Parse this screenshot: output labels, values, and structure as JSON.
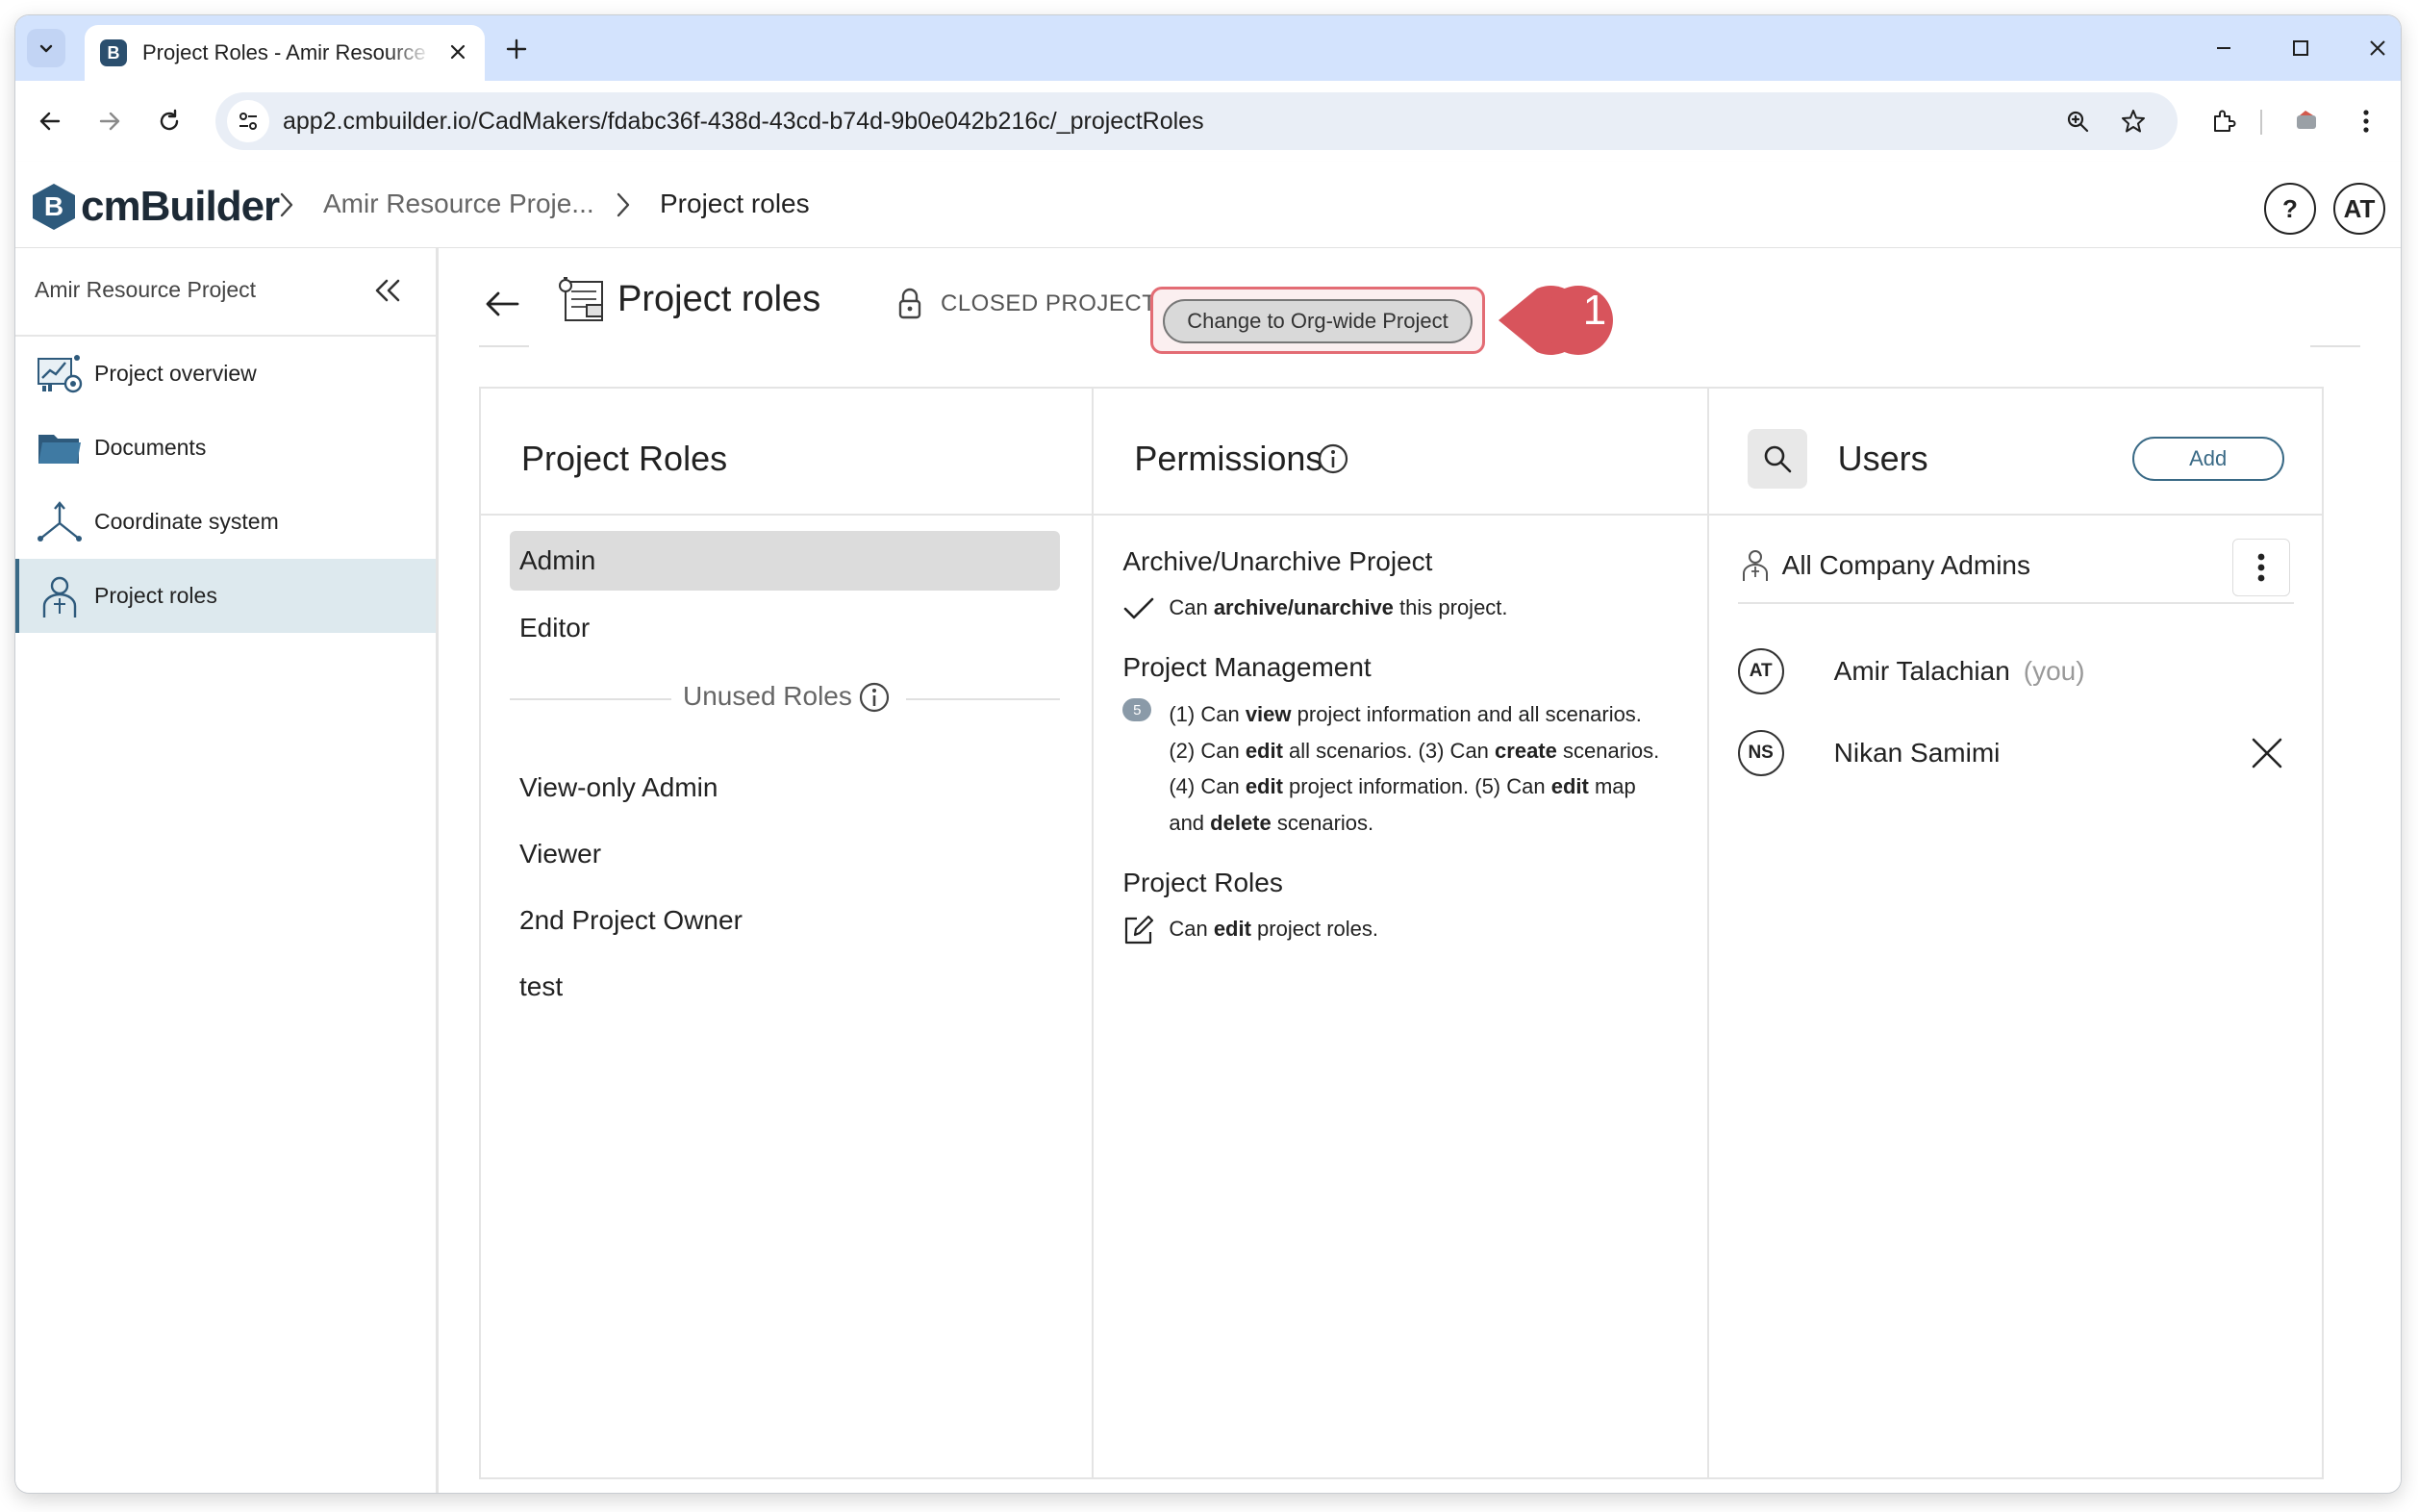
{
  "browser": {
    "tab_title": "Project Roles - Amir Resource Project",
    "favicon_letter": "B",
    "url": "app2.cmbuilder.io/CadMakers/fdabc36f-438d-43cd-b74d-9b0e042b216c/_projectRoles"
  },
  "header": {
    "logo_letter": "B",
    "logo_text": "cmBuilder",
    "breadcrumb_project": "Amir Resource Proje...",
    "breadcrumb_page": "Project roles",
    "help_label": "?",
    "avatar_initials": "AT"
  },
  "sidebar": {
    "project_name": "Amir Resource Project",
    "items": [
      {
        "label": "Project overview",
        "icon": "chart-dashboard-icon"
      },
      {
        "label": "Documents",
        "icon": "folder-icon"
      },
      {
        "label": "Coordinate system",
        "icon": "axes-icon"
      },
      {
        "label": "Project roles",
        "icon": "user-badge-icon",
        "active": true
      }
    ]
  },
  "page": {
    "title": "Project roles",
    "status": "CLOSED PROJECT",
    "change_button": "Change to Org-wide Project",
    "callout_number": "1"
  },
  "roles_panel": {
    "title": "Project Roles",
    "used_roles": [
      "Admin",
      "Editor"
    ],
    "unused_label": "Unused Roles",
    "unused_roles": [
      "View-only Admin",
      "Viewer",
      "2nd Project Owner",
      "test"
    ],
    "selected": "Admin"
  },
  "permissions_panel": {
    "title": "Permissions",
    "sections": [
      {
        "title": "Archive/Unarchive Project",
        "lines": [
          [
            "Can ",
            "archive/unarchive",
            " this project."
          ]
        ]
      },
      {
        "title": "Project Management",
        "badge": "5",
        "lines": [
          [
            "(1) Can ",
            "view",
            " project information and all scenarios."
          ],
          [
            "(2) Can ",
            "edit",
            " all scenarios. (3) Can ",
            "create",
            " scenarios."
          ],
          [
            "(4) Can ",
            "edit",
            " project information. (5) Can ",
            "edit",
            " map"
          ],
          [
            "and ",
            "delete",
            " scenarios."
          ]
        ]
      },
      {
        "title": "Project Roles",
        "lines": [
          [
            "Can ",
            "edit",
            " project roles."
          ]
        ]
      }
    ]
  },
  "users_panel": {
    "title": "Users",
    "add_label": "Add",
    "group_label": "All Company Admins",
    "users": [
      {
        "initials": "AT",
        "name": "Amir Talachian",
        "suffix": "(you)",
        "removable": false
      },
      {
        "initials": "NS",
        "name": "Nikan Samimi",
        "suffix": "",
        "removable": true
      }
    ]
  }
}
